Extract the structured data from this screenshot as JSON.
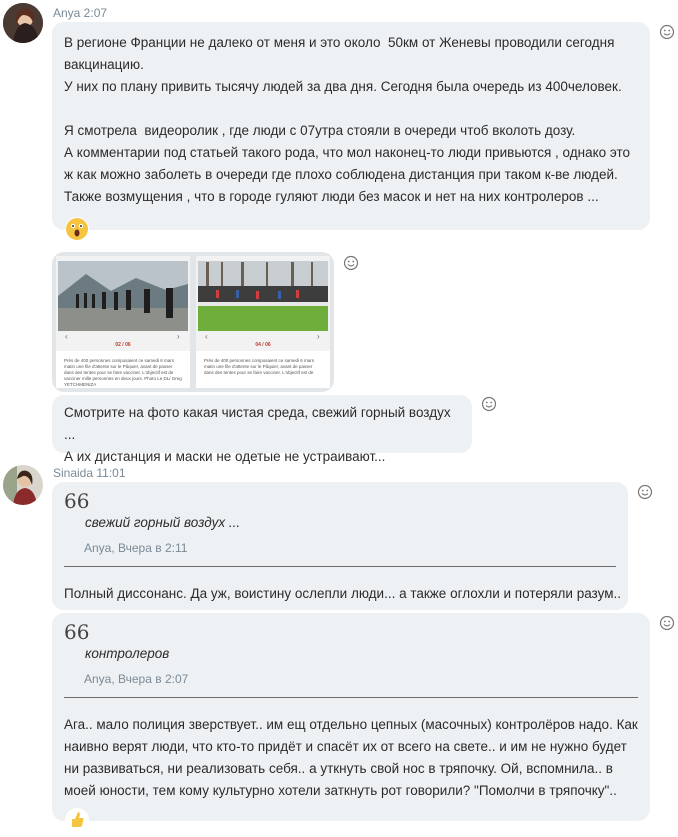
{
  "messages": [
    {
      "sender": "Anya",
      "time": "2:07",
      "header": "Anya 2:07",
      "text": "В регионе Франции не далеко от меня и это около  50км от Женевы проводили сегодня вакцинацию.\nУ них по плану привить тысячу людей за два дня. Сегодня была очередь из 400человек.\n\nЯ смотрела  видеоролик , где люди с 07утра стояли в очереди чтоб вколоть дозу.\nА комментарии под статьей такого рода, что мол наконец-то люди привьются , однако это ж как можно заболеть в очереди где плохо соблюдена дистанция при таком к-ве людей.\nТакже возмущения , что в городе гуляют люди без масок и нет на них контролеров ...",
      "reaction": "shocked-face-emoji"
    },
    {
      "sender": "Anya",
      "images": [
        {
          "icon": "photo-queue-mountains",
          "counter": "02 / 06",
          "caption": "Près de 400 personnes composaient ce samedi 6 mars matin une file d'attente sur le Pâquier, avant de passer dans des tentes pour se faire vacciner. L'objectif est de vacciner mille personnes en deux jours. Photo Le DL/ Greg YETCHMENIZA"
        },
        {
          "icon": "photo-queue-park",
          "counter": "04 / 06",
          "caption": "Près de 400 personnes composaient ce samedi 6 mars matin une file d'attente sur le Pâquier, avant de passer dans des tentes pour se faire vacciner. L'objectif est de"
        }
      ]
    },
    {
      "sender": "Anya",
      "text": "Смотрите на фото какая чистая среда, свежий горный воздух ...\nА их дистанция и маски не одетые не устраивают..."
    },
    {
      "sender": "Sinaida",
      "time": "11:01",
      "header": "Sinaida 11:01",
      "quote": {
        "mark": "66",
        "text": "свежий горный воздух ...",
        "meta": "Anya, Вчера в 2:11"
      },
      "text": "Полный диссонанс. Да уж, воистину ослепли люди... а также оглохли и потеряли разум.."
    },
    {
      "sender": "Sinaida",
      "quote": {
        "mark": "66",
        "text": "контролеров",
        "meta": "Anya, Вчера в 2:07"
      },
      "text": "Ага.. мало полиция зверствует.. им ещ отдельно цепных (масочных) контролёров надо. Как наивно верят люди, что кто-то придёт и спасёт их от всего на свете.. и им не нужно будет ни развиваться, ни реализовать себя.. а уткнуть свой нос в тряпочку. Ой, вспомнила.. в моей юности, тем кому культурно хотели заткнуть рот говорили? \"Помолчи в тряпочку\"..",
      "reaction": "thumbs-up-emoji"
    }
  ],
  "icons": {
    "add_reaction": "smiley-outline-icon"
  },
  "colors": {
    "bubble": "#eef1f4",
    "meta_text": "#7a8a96",
    "text": "#2b2b2b",
    "emoji_yellow": "#f5c542"
  }
}
